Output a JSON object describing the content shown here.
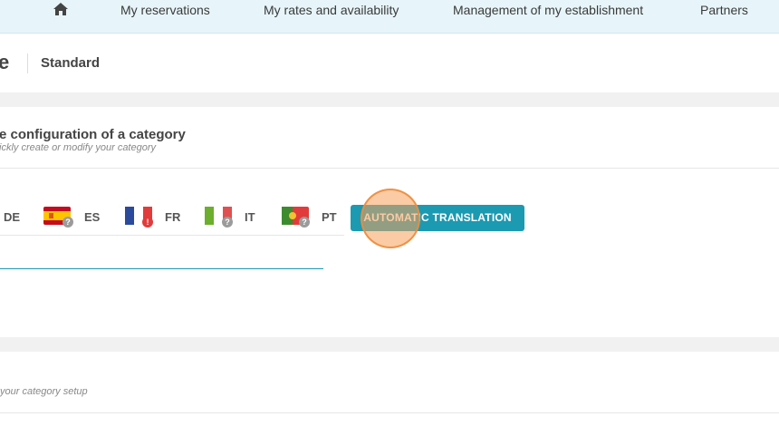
{
  "nav": {
    "items": [
      "My reservations",
      "My rates and availability",
      "Management of my establishment",
      "Partners"
    ]
  },
  "header": {
    "title_fragment": "e",
    "standard_label": "Standard"
  },
  "category_config": {
    "title": "e configuration of a category",
    "subtitle": "ickly create or modify your category"
  },
  "languages": [
    {
      "code": "DE",
      "status": "none"
    },
    {
      "code": "ES",
      "status": "?"
    },
    {
      "code": "FR",
      "status": "!"
    },
    {
      "code": "IT",
      "status": "?"
    },
    {
      "code": "PT",
      "status": "?"
    }
  ],
  "auto_translation_label": "AUTOMATIC TRANSLATION",
  "setup": {
    "subtitle": "your category setup"
  },
  "colors": {
    "accent": "#1b9ab2",
    "nav_bg": "#e7f5fa",
    "error": "#e23b3b"
  }
}
